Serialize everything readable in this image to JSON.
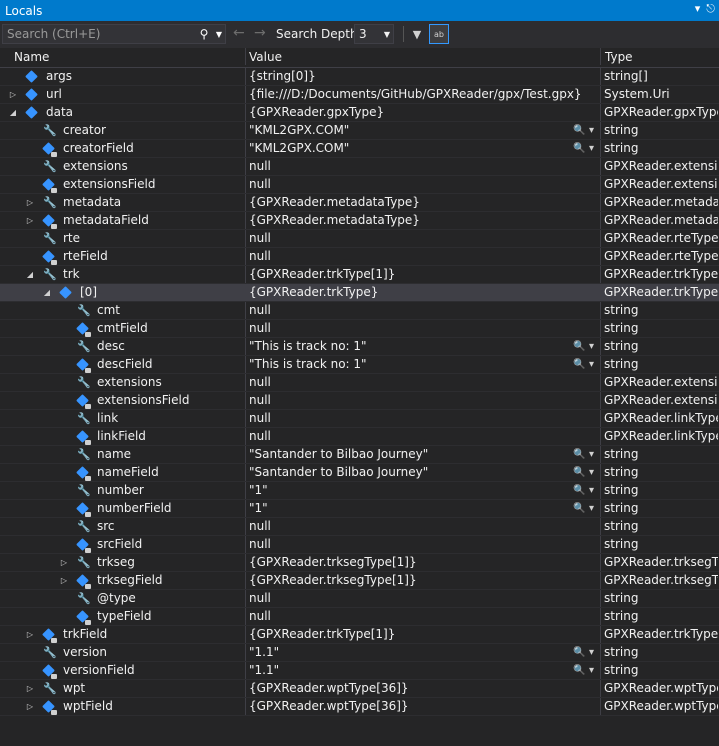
{
  "title": "Locals",
  "title_icons": [
    "chevron-down-icon",
    "pin-icon"
  ],
  "toolbar": {
    "search_placeholder": "Search (Ctrl+E)",
    "depth_label": "Search Depth:",
    "depth_value": "3"
  },
  "columns": {
    "name": "Name",
    "value": "Value",
    "type": "Type"
  },
  "rows": [
    {
      "depth": 0,
      "exp": "",
      "icon": "field",
      "name": "args",
      "value": "{string[0]}",
      "type": "string[]",
      "mag": false
    },
    {
      "depth": 0,
      "exp": "collapsed",
      "icon": "field",
      "name": "url",
      "value": "{file:///D:/Documents/GitHub/GPXReader/gpx/Test.gpx}",
      "type": "System.Uri",
      "mag": false
    },
    {
      "depth": 0,
      "exp": "expanded",
      "icon": "field",
      "name": "data",
      "value": "{GPXReader.gpxType}",
      "type": "GPXReader.gpxType",
      "mag": false
    },
    {
      "depth": 1,
      "exp": "",
      "icon": "property",
      "name": "creator",
      "value": "\"KML2GPX.COM\"",
      "type": "string",
      "mag": true
    },
    {
      "depth": 1,
      "exp": "",
      "icon": "private-field",
      "name": "creatorField",
      "value": "\"KML2GPX.COM\"",
      "type": "string",
      "mag": true
    },
    {
      "depth": 1,
      "exp": "",
      "icon": "property",
      "name": "extensions",
      "value": "null",
      "type": "GPXReader.extensi...",
      "mag": false
    },
    {
      "depth": 1,
      "exp": "",
      "icon": "private-field",
      "name": "extensionsField",
      "value": "null",
      "type": "GPXReader.extensi...",
      "mag": false
    },
    {
      "depth": 1,
      "exp": "collapsed",
      "icon": "property",
      "name": "metadata",
      "value": "{GPXReader.metadataType}",
      "type": "GPXReader.metada...",
      "mag": false
    },
    {
      "depth": 1,
      "exp": "collapsed",
      "icon": "private-field",
      "name": "metadataField",
      "value": "{GPXReader.metadataType}",
      "type": "GPXReader.metada...",
      "mag": false
    },
    {
      "depth": 1,
      "exp": "",
      "icon": "property",
      "name": "rte",
      "value": "null",
      "type": "GPXReader.rteType[]",
      "mag": false
    },
    {
      "depth": 1,
      "exp": "",
      "icon": "private-field",
      "name": "rteField",
      "value": "null",
      "type": "GPXReader.rteType[]",
      "mag": false
    },
    {
      "depth": 1,
      "exp": "expanded",
      "icon": "property",
      "name": "trk",
      "value": "{GPXReader.trkType[1]}",
      "type": "GPXReader.trkType[]",
      "mag": false
    },
    {
      "depth": 2,
      "exp": "expanded",
      "icon": "field",
      "name": "[0]",
      "value": "{GPXReader.trkType}",
      "type": "GPXReader.trkType",
      "mag": false,
      "selected": true
    },
    {
      "depth": 3,
      "exp": "",
      "icon": "property",
      "name": "cmt",
      "value": "null",
      "type": "string",
      "mag": false
    },
    {
      "depth": 3,
      "exp": "",
      "icon": "private-field",
      "name": "cmtField",
      "value": "null",
      "type": "string",
      "mag": false
    },
    {
      "depth": 3,
      "exp": "",
      "icon": "property",
      "name": "desc",
      "value": "\"This is track no: 1\"",
      "type": "string",
      "mag": true
    },
    {
      "depth": 3,
      "exp": "",
      "icon": "private-field",
      "name": "descField",
      "value": "\"This is track no: 1\"",
      "type": "string",
      "mag": true
    },
    {
      "depth": 3,
      "exp": "",
      "icon": "property",
      "name": "extensions",
      "value": "null",
      "type": "GPXReader.extensi...",
      "mag": false
    },
    {
      "depth": 3,
      "exp": "",
      "icon": "private-field",
      "name": "extensionsField",
      "value": "null",
      "type": "GPXReader.extensi...",
      "mag": false
    },
    {
      "depth": 3,
      "exp": "",
      "icon": "property",
      "name": "link",
      "value": "null",
      "type": "GPXReader.linkType[]",
      "mag": false
    },
    {
      "depth": 3,
      "exp": "",
      "icon": "private-field",
      "name": "linkField",
      "value": "null",
      "type": "GPXReader.linkType[]",
      "mag": false
    },
    {
      "depth": 3,
      "exp": "",
      "icon": "property",
      "name": "name",
      "value": "\"Santander to Bilbao Journey\"",
      "type": "string",
      "mag": true
    },
    {
      "depth": 3,
      "exp": "",
      "icon": "private-field",
      "name": "nameField",
      "value": "\"Santander to Bilbao Journey\"",
      "type": "string",
      "mag": true
    },
    {
      "depth": 3,
      "exp": "",
      "icon": "property",
      "name": "number",
      "value": "\"1\"",
      "type": "string",
      "mag": true
    },
    {
      "depth": 3,
      "exp": "",
      "icon": "private-field",
      "name": "numberField",
      "value": "\"1\"",
      "type": "string",
      "mag": true
    },
    {
      "depth": 3,
      "exp": "",
      "icon": "property",
      "name": "src",
      "value": "null",
      "type": "string",
      "mag": false
    },
    {
      "depth": 3,
      "exp": "",
      "icon": "private-field",
      "name": "srcField",
      "value": "null",
      "type": "string",
      "mag": false
    },
    {
      "depth": 3,
      "exp": "collapsed",
      "icon": "property",
      "name": "trkseg",
      "value": "{GPXReader.trksegType[1]}",
      "type": "GPXReader.trksegTy...",
      "mag": false
    },
    {
      "depth": 3,
      "exp": "collapsed",
      "icon": "private-field",
      "name": "trksegField",
      "value": "{GPXReader.trksegType[1]}",
      "type": "GPXReader.trksegTy...",
      "mag": false
    },
    {
      "depth": 3,
      "exp": "",
      "icon": "property",
      "name": "@type",
      "value": "null",
      "type": "string",
      "mag": false
    },
    {
      "depth": 3,
      "exp": "",
      "icon": "private-field",
      "name": "typeField",
      "value": "null",
      "type": "string",
      "mag": false
    },
    {
      "depth": 1,
      "exp": "collapsed",
      "icon": "private-field",
      "name": "trkField",
      "value": "{GPXReader.trkType[1]}",
      "type": "GPXReader.trkType[]",
      "mag": false
    },
    {
      "depth": 1,
      "exp": "",
      "icon": "property",
      "name": "version",
      "value": "\"1.1\"",
      "type": "string",
      "mag": true
    },
    {
      "depth": 1,
      "exp": "",
      "icon": "private-field",
      "name": "versionField",
      "value": "\"1.1\"",
      "type": "string",
      "mag": true
    },
    {
      "depth": 1,
      "exp": "collapsed",
      "icon": "property",
      "name": "wpt",
      "value": "{GPXReader.wptType[36]}",
      "type": "GPXReader.wptType[]",
      "mag": false
    },
    {
      "depth": 1,
      "exp": "collapsed",
      "icon": "private-field",
      "name": "wptField",
      "value": "{GPXReader.wptType[36]}",
      "type": "GPXReader.wptType[]",
      "mag": false
    }
  ]
}
